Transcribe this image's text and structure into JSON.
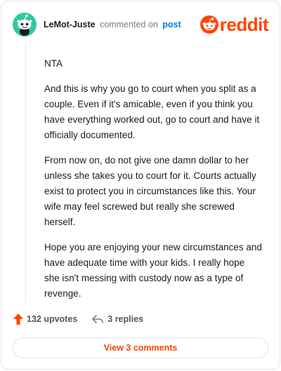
{
  "header": {
    "username": "LeMot-Juste",
    "action": "commented on",
    "post_link": "post",
    "brand_name": "reddit",
    "brand_icon": "reddit-alien-icon",
    "avatar_icon": "snoo-avatar-icon"
  },
  "comment": {
    "paragraphs": [
      "NTA",
      "And this is why you go to court when you split as a couple. Even if it's amicable, even if you think you have everything worked out, go to court and have it officially documented.",
      "From now on, do not give one damn dollar to her unless she takes you to court for it. Courts actually exist to protect you in circumstances like this. Your wife may feel screwed but really she screwed herself.",
      "Hope you are enjoying your new circumstances and have adequate time with your kids. I really hope she isn't messing with custody now as a type of revenge."
    ]
  },
  "actions": {
    "upvotes": "132 upvotes",
    "replies": "3 replies",
    "upvote_icon": "upvote-arrow-icon",
    "reply_icon": "reply-arrow-icon"
  },
  "footer": {
    "view_comments": "View 3 comments"
  },
  "colors": {
    "brand": "#ff4500",
    "link": "#0079d3",
    "avatar": "#2ec9a3",
    "text": "#1c1c1c",
    "muted": "#7c7c7c",
    "border": "#e3e5e8"
  }
}
